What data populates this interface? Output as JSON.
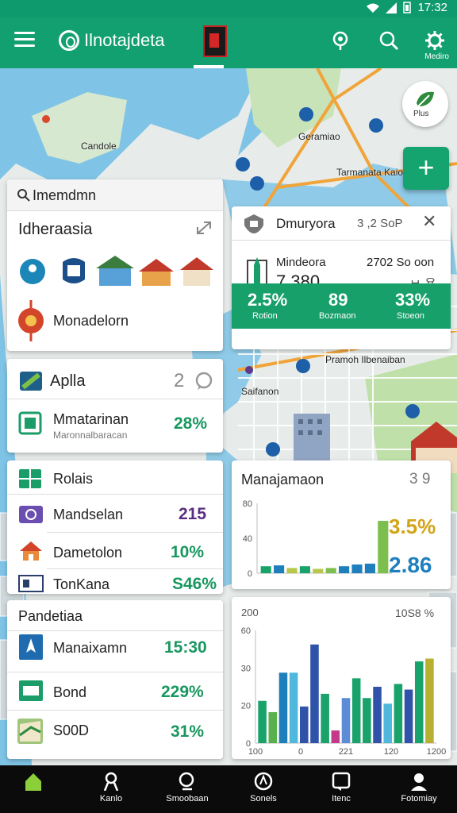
{
  "status_bar": {
    "time": "17:32"
  },
  "app_bar": {
    "title": "Ilnotajdeta",
    "settings_label": "Mediro"
  },
  "map": {
    "labels": [
      "Candole",
      "Geramiao",
      "Tarmanata Kaiot",
      "Saifanon",
      "Pramoh Ilbenaiban"
    ],
    "leaf_button_label": "Plus"
  },
  "card_search": {
    "header": "Imemdmn",
    "title": "Idheraasia",
    "place_label": "Monadelorn"
  },
  "card_overview": {
    "title": "Dmuryora",
    "meta": "3 ,2 SoP",
    "metric_label": "Mindeora",
    "metric_value": "7.380",
    "right_value": "2702 So oon",
    "right_sub": "ㅂ.용",
    "stats": [
      {
        "value": "2.5%",
        "label": "Rotion"
      },
      {
        "value": "89",
        "label": "Bozmaon"
      },
      {
        "value": "33%",
        "label": "Stoeon"
      }
    ]
  },
  "card_apps": {
    "title": "Aplla",
    "count": "2",
    "item_title": "Mmatarinan",
    "item_subtitle": "Maronnalbaracan",
    "item_value": "28%"
  },
  "card_list": {
    "header": "Rolais",
    "rows": [
      {
        "label": "Mandselan",
        "value": "215"
      },
      {
        "label": "Dametolon",
        "value": "10%"
      },
      {
        "label": "TonKana",
        "value": "S46%"
      }
    ]
  },
  "card_chart_small": {
    "title": "Manajamaon",
    "meta": "3 9",
    "value_gold": "3.5%",
    "value_blue": "2.86",
    "chart_data": {
      "type": "bar",
      "y_ticks": [
        "80",
        "40",
        "0"
      ],
      "values": [
        8,
        9,
        6,
        8,
        5,
        6,
        8,
        10,
        11,
        60
      ],
      "colors": [
        "#19a36a",
        "#1f7fbd",
        "#b7c84a",
        "#19a36a",
        "#b7c84a",
        "#7dbf4e",
        "#1f7fbd",
        "#1f7fbd",
        "#1f7fbd",
        "#7dbf4e"
      ],
      "ylim": [
        0,
        80
      ]
    }
  },
  "card_list2": {
    "header": "Pandetiaa",
    "rows": [
      {
        "label": "Manaixamn",
        "value": "15:30"
      },
      {
        "label": "Bond",
        "value": "229%"
      },
      {
        "label": "S00D",
        "value": "31%"
      }
    ]
  },
  "card_chart_big": {
    "top_left": "200",
    "top_right": "10S8 %",
    "chart_data": {
      "type": "bar",
      "y_ticks": [
        "60",
        "30",
        "20",
        "0"
      ],
      "x_ticks": [
        "100",
        "0",
        "221",
        "120",
        "1200"
      ],
      "values": [
        30,
        22,
        50,
        50,
        26,
        70,
        35,
        9,
        32,
        46,
        32,
        40,
        28,
        42,
        38,
        58,
        60
      ],
      "colors": [
        "#19a36a",
        "#5ab04d",
        "#1f7fbd",
        "#4fb8dc",
        "#2f53a8",
        "#2f53a8",
        "#19a36a",
        "#c43a8a",
        "#5c8cd6",
        "#19a36a",
        "#19a36a",
        "#2f53a8",
        "#4fb8dc",
        "#19a36a",
        "#2f53a8",
        "#19a36a",
        "#b7b032"
      ],
      "ylim": [
        0,
        80
      ]
    }
  },
  "bottom_nav": [
    {
      "label": ""
    },
    {
      "label": "Kanlo"
    },
    {
      "label": "Smoobaan"
    },
    {
      "label": "Sonels"
    },
    {
      "label": "Itenc"
    },
    {
      "label": "Fotomiay"
    }
  ]
}
